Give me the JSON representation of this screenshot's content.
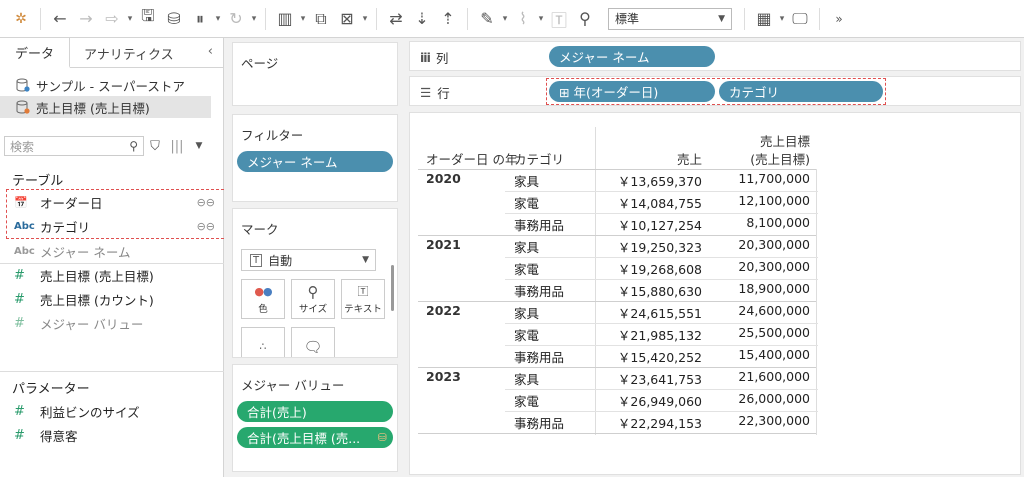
{
  "toolbar": {
    "icons": [
      "tableau-logo-icon",
      "undo-icon",
      "redo-icon",
      "replay-icon",
      "save-icon",
      "new-datasource-icon",
      "pause-update-icon",
      "refresh-icon",
      "new-worksheet-icon",
      "duplicate-icon",
      "clear-icon",
      "swap-icon",
      "sort-asc-icon",
      "sort-desc-icon",
      "highlight-icon",
      "group-icon",
      "label-icon",
      "pin-icon",
      "show-me-icon",
      "presentation-icon"
    ],
    "fit_select": "標準"
  },
  "data_pane": {
    "tab_data": "データ",
    "tab_analytics": "アナリティクス",
    "collapse": "‹",
    "datasources": [
      "サンプル - スーパーストア",
      "売上目標 (売上目標)"
    ],
    "search_placeholder": "検索",
    "tables_title": "テーブル",
    "fields": [
      {
        "icon": "calendar-icon",
        "label": "オーダー日"
      },
      {
        "icon": "Abc",
        "label": "カテゴリ"
      },
      {
        "icon": "Abc",
        "label": "メジャー ネーム"
      },
      {
        "icon": "#",
        "label": "売上目標 (売上目標)"
      },
      {
        "icon": "#",
        "label": "売上目標 (カウント)"
      },
      {
        "icon": "#",
        "label": "メジャー バリュー"
      }
    ],
    "parameters_title": "パラメーター",
    "parameters": [
      "利益ビンのサイズ",
      "得意客"
    ]
  },
  "cards": {
    "pages_title": "ページ",
    "filters_title": "フィルター",
    "filter_pill": "メジャー ネーム",
    "marks_title": "マーク",
    "marks_type": "自動",
    "mark_buttons": [
      {
        "icon": "color-icon",
        "label": "色"
      },
      {
        "icon": "size-icon",
        "label": "サイズ"
      },
      {
        "icon": "text-icon",
        "label": "テキスト"
      },
      {
        "icon": "detail-icon",
        "label": ""
      },
      {
        "icon": "tooltip-icon",
        "label": ""
      }
    ],
    "measure_values_title": "メジャー バリュー",
    "measure_pills": [
      "合計(売上)",
      "合計(売上目標 (売..."
    ]
  },
  "shelves": {
    "columns_label": "列",
    "columns_pill": "メジャー ネーム",
    "rows_label": "行",
    "rows_pills": [
      "⊞ 年(オーダー日)",
      "カテゴリ"
    ]
  },
  "view": {
    "headers": {
      "year": "オーダー日 の年",
      "category": "カテゴリ",
      "sales": "売上",
      "target_line1": "売上目標",
      "target_line2": "(売上目標)"
    },
    "groups": [
      {
        "year": "2020",
        "rows": [
          {
            "category": "家具",
            "sales": "￥13,659,370",
            "target": "11,700,000"
          },
          {
            "category": "家電",
            "sales": "￥14,084,755",
            "target": "12,100,000"
          },
          {
            "category": "事務用品",
            "sales": "￥10,127,254",
            "target": "8,100,000"
          }
        ]
      },
      {
        "year": "2021",
        "rows": [
          {
            "category": "家具",
            "sales": "￥19,250,323",
            "target": "20,300,000"
          },
          {
            "category": "家電",
            "sales": "￥19,268,608",
            "target": "20,300,000"
          },
          {
            "category": "事務用品",
            "sales": "￥15,880,630",
            "target": "18,900,000"
          }
        ]
      },
      {
        "year": "2022",
        "rows": [
          {
            "category": "家具",
            "sales": "￥24,615,551",
            "target": "24,600,000"
          },
          {
            "category": "家電",
            "sales": "￥21,985,132",
            "target": "25,500,000"
          },
          {
            "category": "事務用品",
            "sales": "￥15,420,252",
            "target": "15,400,000"
          }
        ]
      },
      {
        "year": "2023",
        "rows": [
          {
            "category": "家具",
            "sales": "￥23,641,753",
            "target": "21,600,000"
          },
          {
            "category": "家電",
            "sales": "￥26,949,060",
            "target": "26,000,000"
          },
          {
            "category": "事務用品",
            "sales": "￥22,294,153",
            "target": "22,300,000"
          }
        ]
      }
    ]
  },
  "colors": {
    "pill_blue": "#4b8fae",
    "pill_green": "#27a86e",
    "highlight_dash": "#e05050"
  }
}
